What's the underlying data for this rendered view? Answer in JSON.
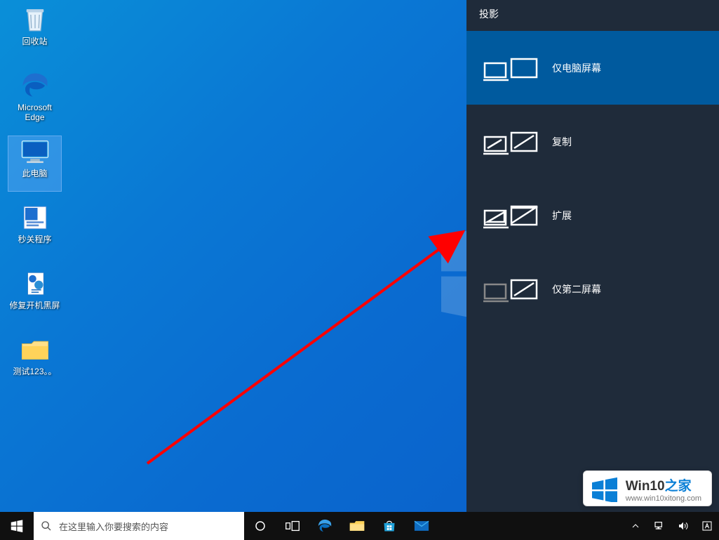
{
  "desktop": {
    "icons": {
      "recycle_bin": "回收站",
      "edge": "Microsoft\nEdge",
      "this_pc": "此电脑",
      "seconds_off": "秒关程序",
      "fix_boot": "修复开机黑屏",
      "test_folder": "测试123。。"
    }
  },
  "project_panel": {
    "title": "投影",
    "options": {
      "pc_only": "仅电脑屏幕",
      "duplicate": "复制",
      "extend": "扩展",
      "second_only": "仅第二屏幕"
    }
  },
  "taskbar": {
    "search_placeholder": "在这里输入你要搜索的内容"
  },
  "watermark": {
    "brand_prefix": "Win10",
    "brand_suffix": "之家",
    "url": "www.win10xitong.com"
  }
}
